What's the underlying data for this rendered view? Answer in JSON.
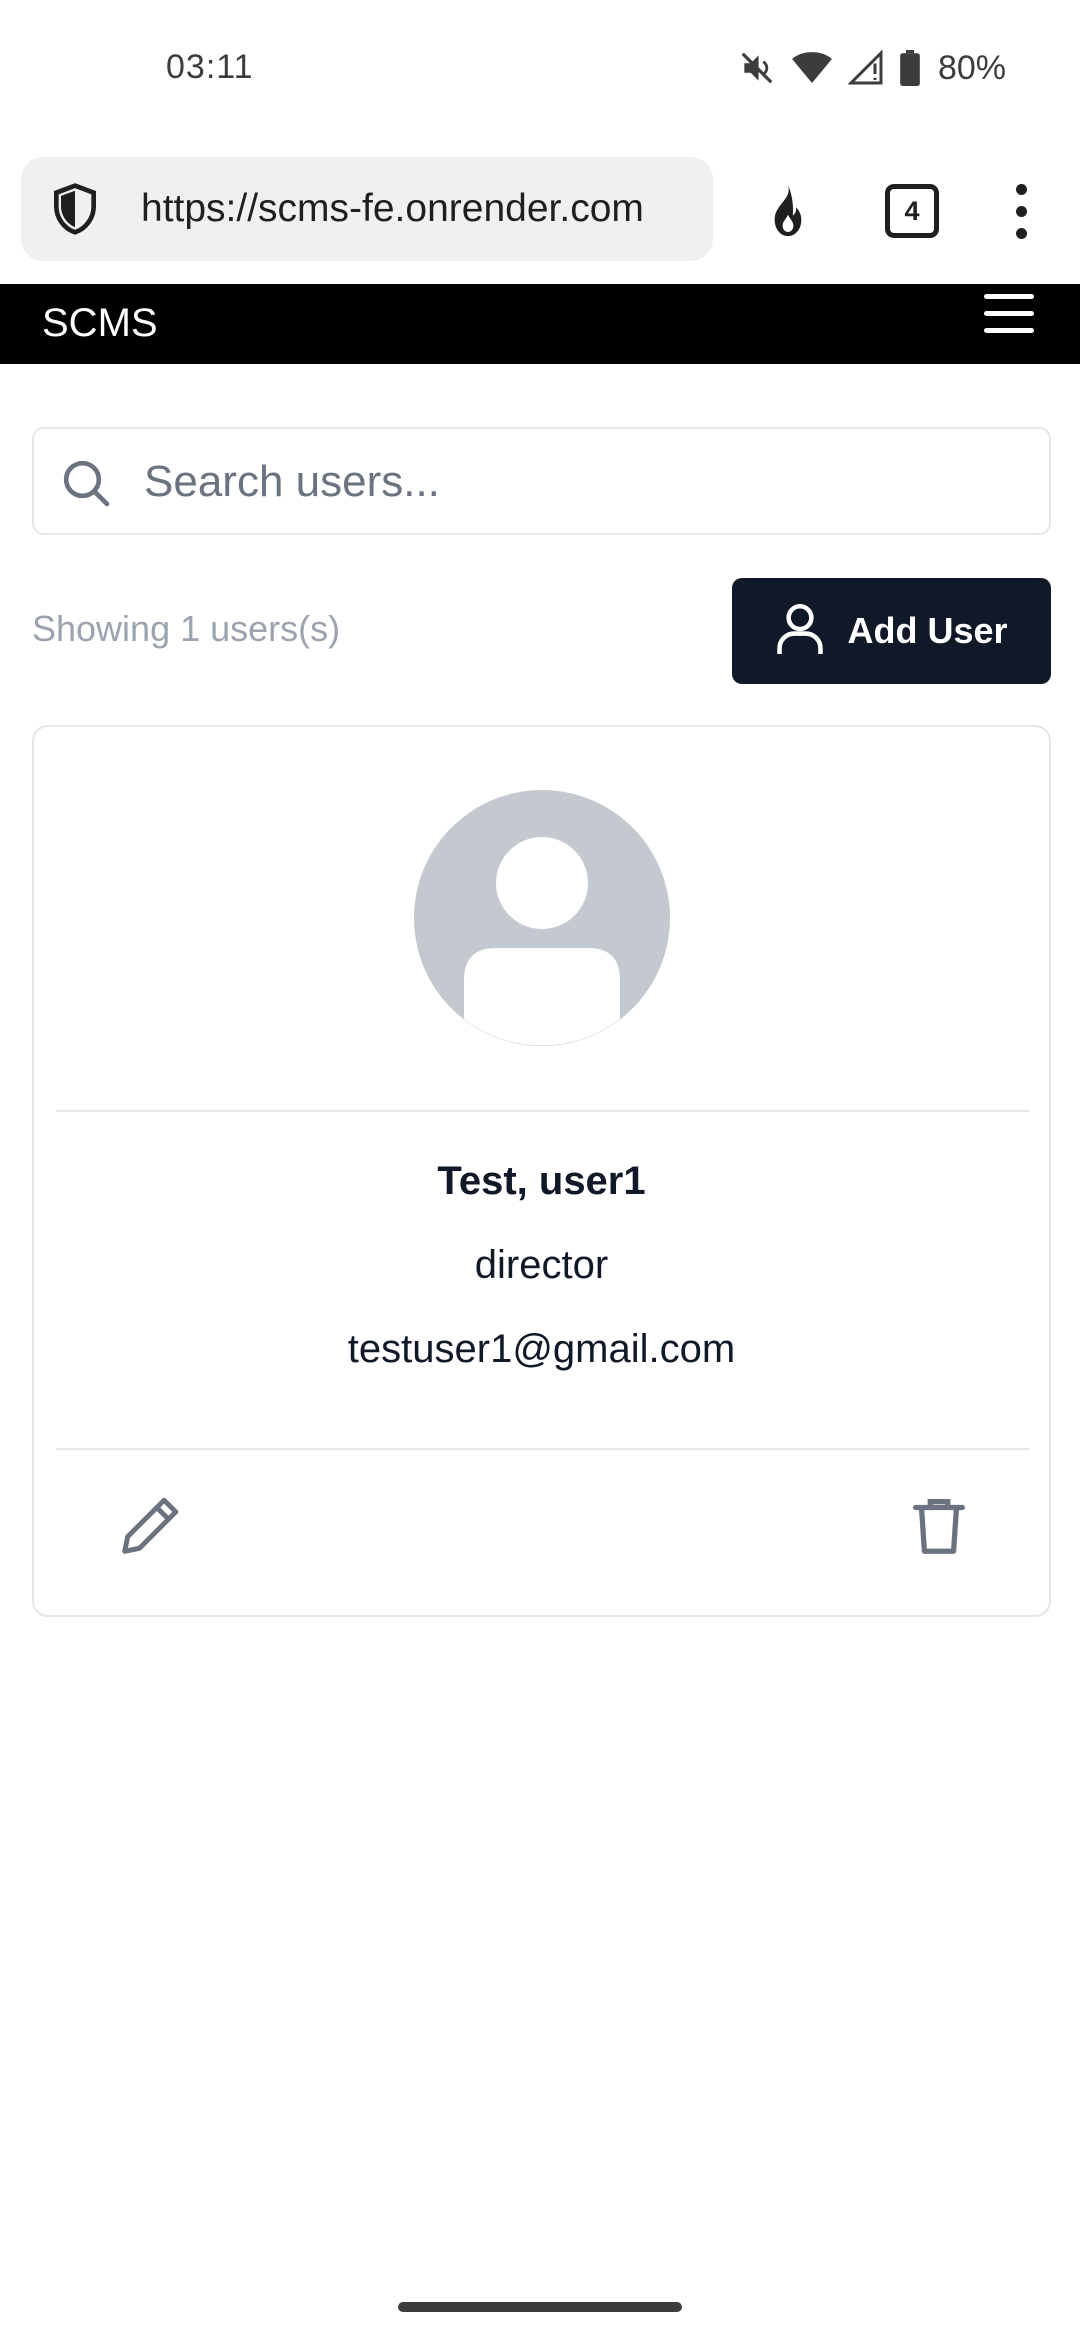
{
  "status_bar": {
    "time": "03:11",
    "battery": "80%",
    "icons": [
      "mute-icon",
      "wifi-icon",
      "signal-icon",
      "battery-icon"
    ]
  },
  "browser": {
    "url": "https://scms-fe.onrender.com",
    "tab_count": "4",
    "icons": [
      "shield-icon",
      "fire-icon",
      "more-vert-icon"
    ]
  },
  "navbar": {
    "brand": "SCMS"
  },
  "search": {
    "placeholder": "Search users...",
    "value": ""
  },
  "list": {
    "count_text": "Showing 1 users(s)",
    "add_button_label": "Add User"
  },
  "users": [
    {
      "name": "Test, user1",
      "role": "director",
      "email": "testuser1@gmail.com"
    }
  ],
  "colors": {
    "navbar_bg": "#000000",
    "primary_button": "#111827",
    "muted_text": "#9ca3af",
    "avatar_bg": "#c4c8cf",
    "icon_gray": "#6b7280"
  }
}
